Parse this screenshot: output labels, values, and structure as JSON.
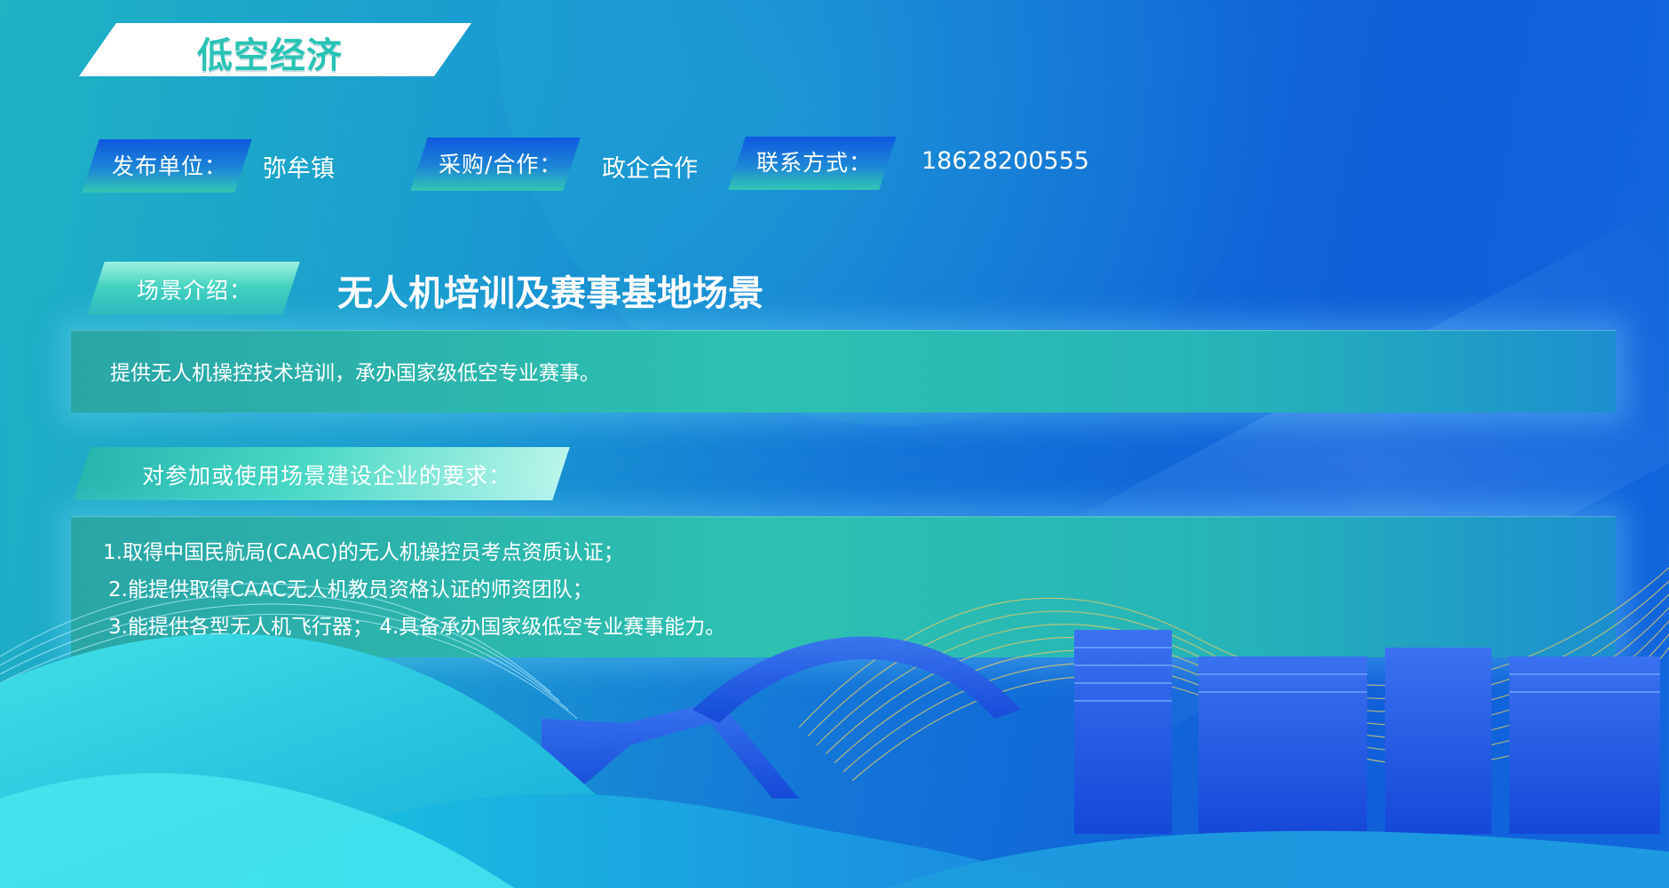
{
  "header": {
    "title": "低空经济"
  },
  "info": {
    "publisher_label": "发布单位：",
    "publisher_value": "弥牟镇",
    "purchase_label": "采购/合作：",
    "purchase_value": "政企合作",
    "contact_label": "联系方式：",
    "contact_value": "18628200555"
  },
  "scene": {
    "label": "场景介绍：",
    "title": "无人机培训及赛事基地场景",
    "description": "提供无人机操控技术培训，承办国家级低空专业赛事。"
  },
  "requirements": {
    "label": "对参加或使用场景建设企业的要求：",
    "lines": [
      "1.取得中国民航局(CAAC)的无人机操控员考点资质认证；",
      "2.能提供取得CAAC无人机教员资格认证的师资团队；",
      "3.能提供各型无人机飞行器； 4.具备承办国家级低空专业赛事能力。"
    ]
  },
  "colors": {
    "background_start": "#1fb3c4",
    "background_end": "#0f5fd8",
    "accent_teal": "#2dc1b1",
    "title_color": "#28c3b5"
  }
}
